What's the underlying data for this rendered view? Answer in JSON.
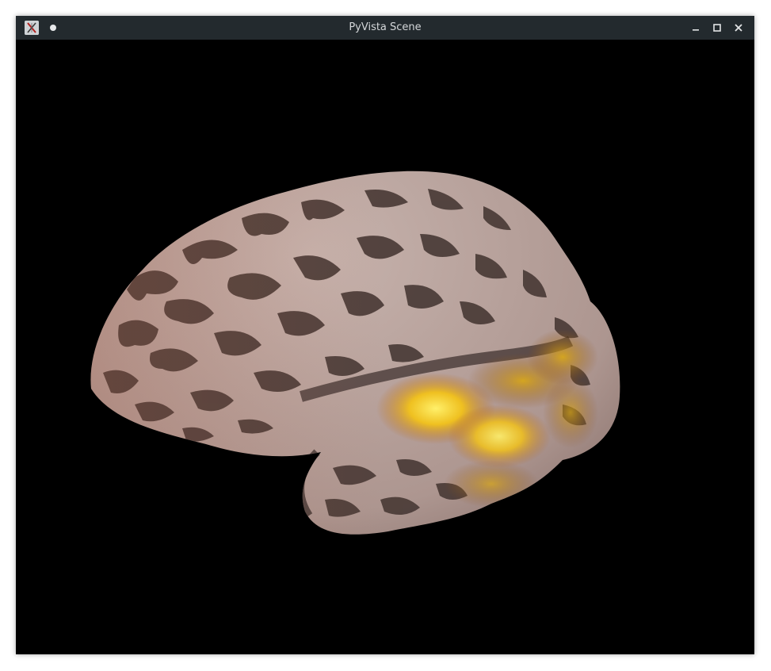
{
  "window": {
    "title": "PyVista Scene",
    "controls": [
      "minimize",
      "maximize",
      "close"
    ]
  },
  "titlebar": {
    "app_icon": "x-icon",
    "sticky_indicator": "dot-icon"
  },
  "viewport": {
    "background": "#000000",
    "content": "inflated-brain-surface",
    "colors": {
      "gyri": "#b8a49e",
      "sulci": "#4a3c38",
      "activation_low": "#c06a10",
      "activation_high": "#ffe42a"
    }
  }
}
